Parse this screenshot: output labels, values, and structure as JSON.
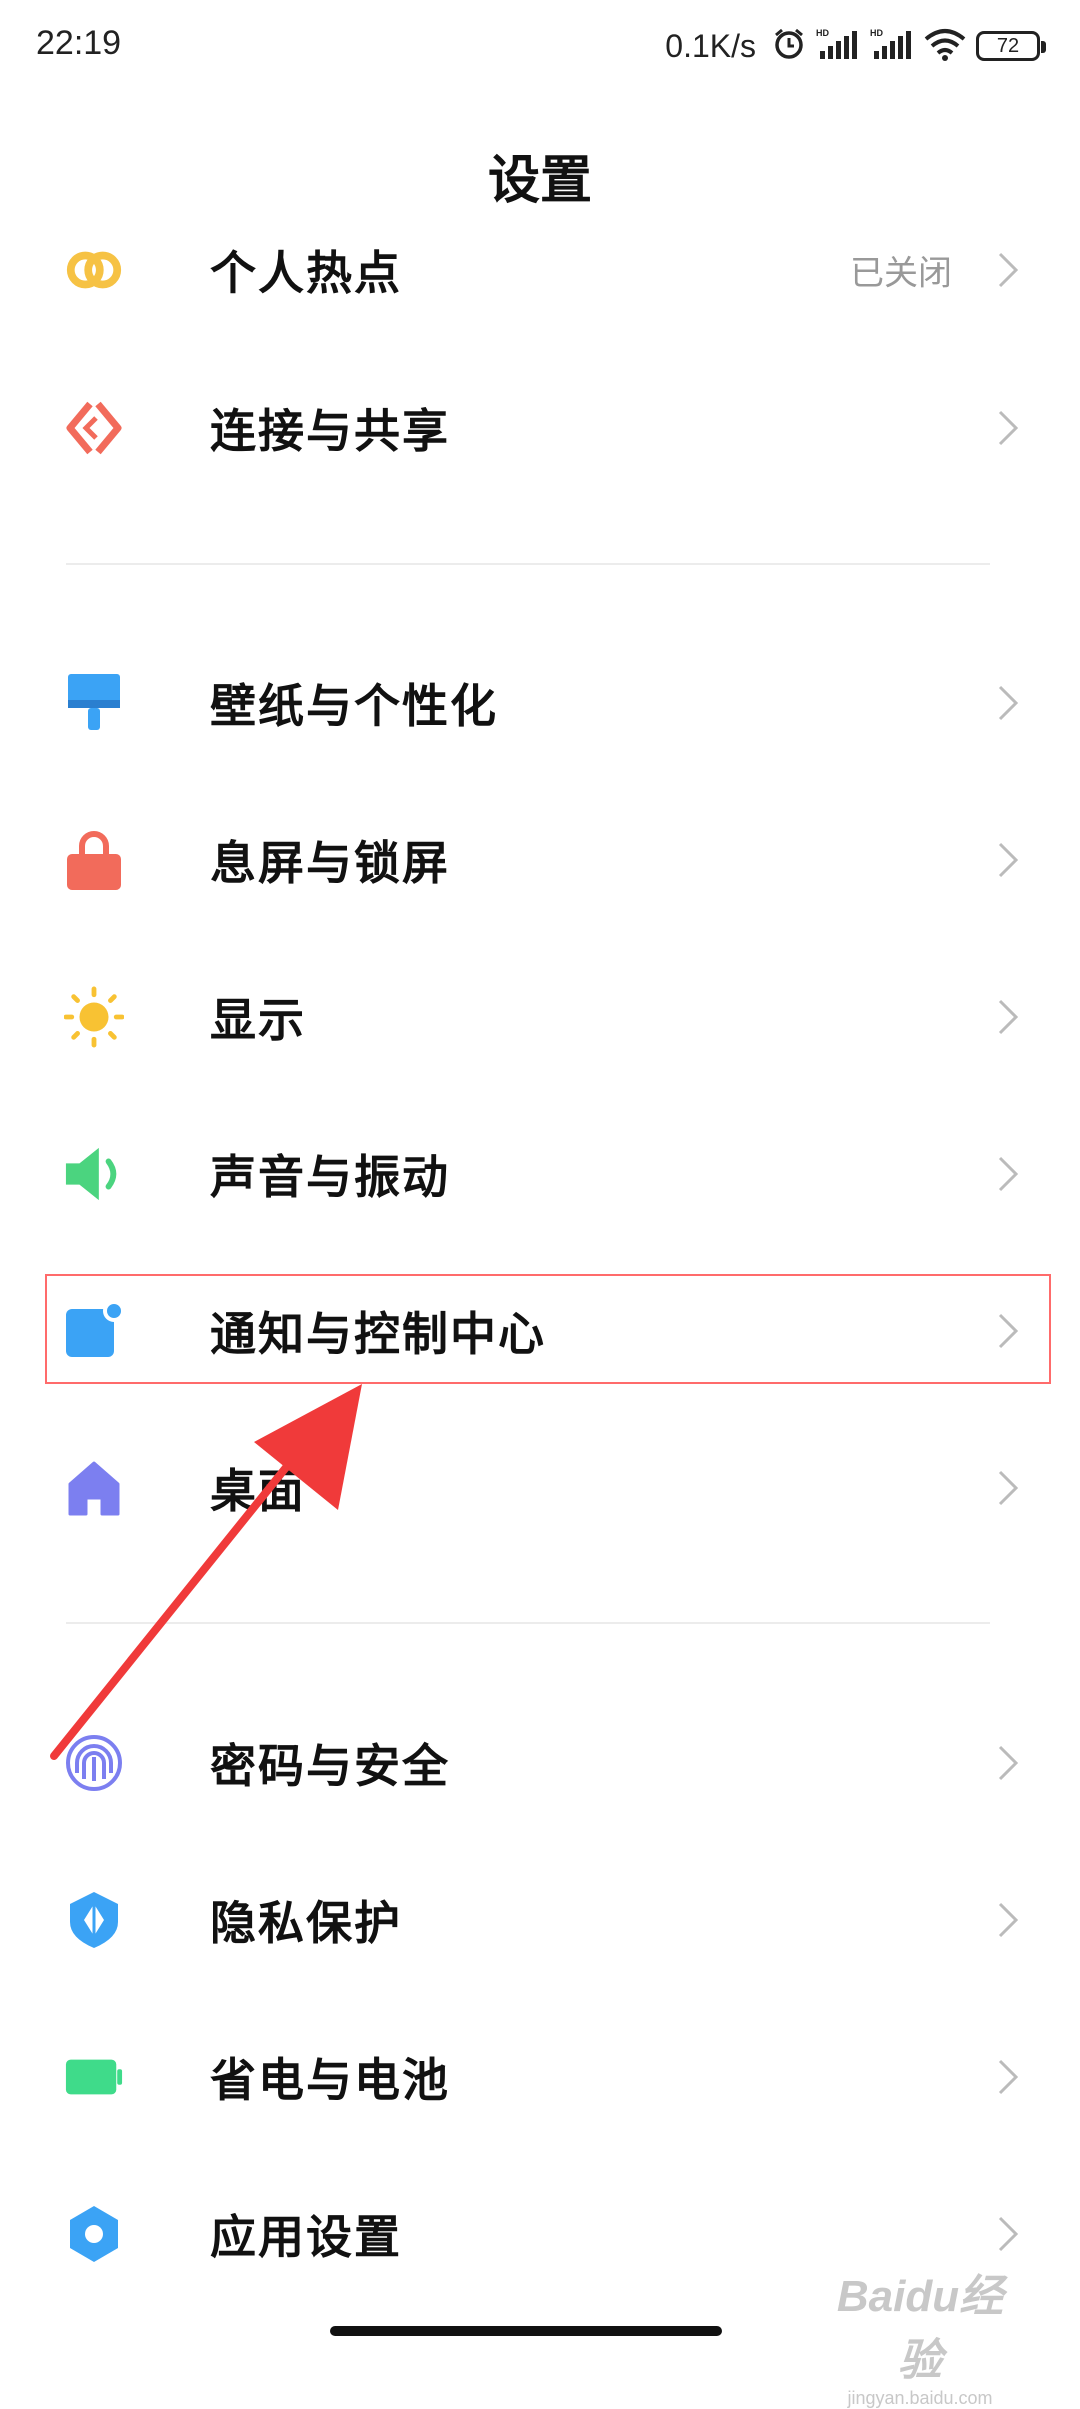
{
  "status_bar": {
    "time": "22:19",
    "net_speed": "0.1K/s",
    "battery_level": "72",
    "icons": [
      "alarm-icon",
      "signal-hd-icon",
      "signal-hd-icon",
      "wifi-icon",
      "battery-icon"
    ]
  },
  "title": "设置",
  "items": [
    {
      "label": "个人热点",
      "status": "已关闭",
      "icon": "hotspot-icon",
      "color": "#f6c244"
    },
    {
      "label": "连接与共享",
      "icon": "connection-share-icon",
      "color": "#f26b5b"
    },
    {
      "label": "壁纸与个性化",
      "icon": "wallpaper-brush-icon",
      "color": "#3ba3f5"
    },
    {
      "label": "息屏与锁屏",
      "icon": "lock-icon",
      "color": "#f26b5b"
    },
    {
      "label": "显示",
      "icon": "sun-icon",
      "color": "#f8c233"
    },
    {
      "label": "声音与振动",
      "icon": "speaker-icon",
      "color": "#4bd47f"
    },
    {
      "label": "通知与控制中心",
      "icon": "notification-icon",
      "color": "#3ba3f5"
    },
    {
      "label": "桌面",
      "icon": "home-icon",
      "color": "#7c7ff0"
    },
    {
      "label": "密码与安全",
      "icon": "fingerprint-icon",
      "color": "#7c7ff0"
    },
    {
      "label": "隐私保护",
      "icon": "privacy-shield-icon",
      "color": "#3ba3f5"
    },
    {
      "label": "省电与电池",
      "icon": "battery-icon",
      "color": "#3fdb8a"
    },
    {
      "label": "应用设置",
      "icon": "gear-icon",
      "color": "#3ba3f5"
    }
  ],
  "annotation": {
    "highlight_color": "#ff6b6b",
    "arrow_color": "#f03a3a"
  },
  "watermark": {
    "main": "Baidu经验",
    "sub": "jingyan.baidu.com"
  }
}
